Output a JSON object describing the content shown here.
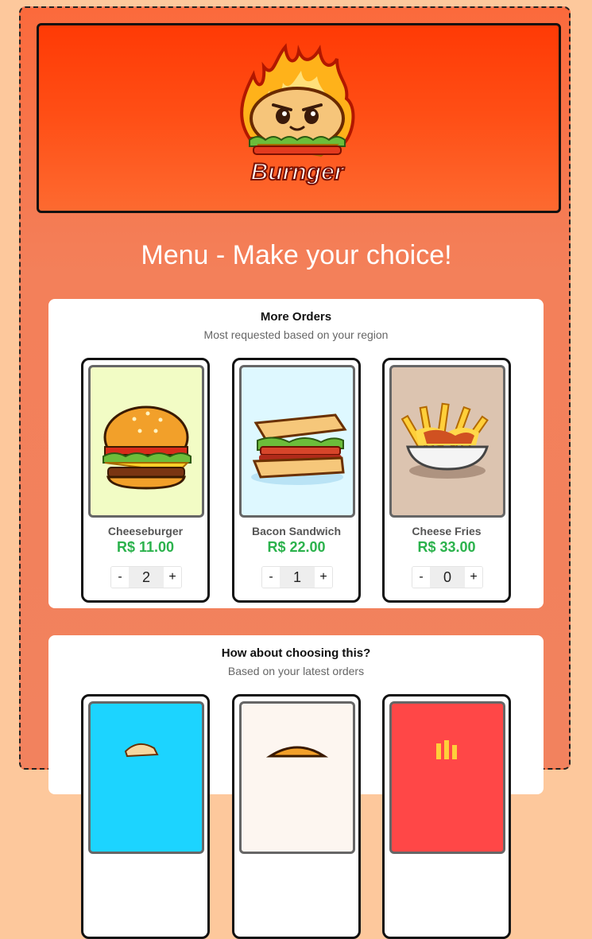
{
  "brand": {
    "name": "Burnger"
  },
  "page_title": "Menu - Make your choice!",
  "sections": [
    {
      "title": "More Orders",
      "subtitle": "Most requested based on your region",
      "items": [
        {
          "name": "Cheeseburger",
          "price": "R$ 11.00",
          "qty": "2",
          "minus": "-",
          "plus": "+"
        },
        {
          "name": "Bacon Sandwich",
          "price": "R$ 22.00",
          "qty": "1",
          "minus": "-",
          "plus": "+"
        },
        {
          "name": "Cheese Fries",
          "price": "R$ 33.00",
          "qty": "0",
          "minus": "-",
          "plus": "+"
        }
      ]
    },
    {
      "title": "How about choosing this?",
      "subtitle": "Based on your latest orders",
      "items": []
    }
  ],
  "colors": {
    "accent_green": "#2bb24c",
    "brand_orange": "#ff3a05",
    "page_bg": "#fdc89c"
  }
}
